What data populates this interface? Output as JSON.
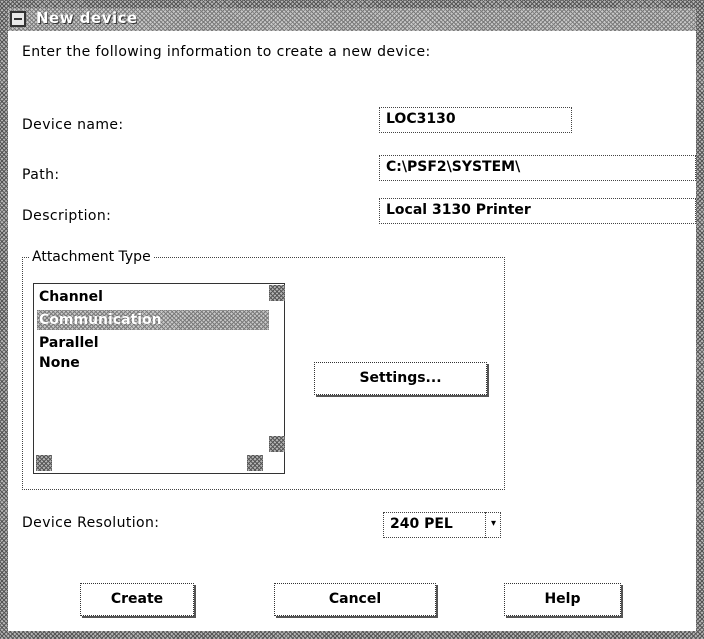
{
  "window": {
    "title": "New device"
  },
  "intro": "Enter the following information to create a new device:",
  "fields": {
    "device_name": {
      "label": "Device name:",
      "value": "LOC3130"
    },
    "path": {
      "label": "Path:",
      "value": "C:\\PSF2\\SYSTEM\\"
    },
    "description": {
      "label": "Description:",
      "value": "Local 3130 Printer"
    }
  },
  "attachment": {
    "group_label": "Attachment Type",
    "items": [
      "Channel",
      "Communication",
      "Parallel",
      "None"
    ],
    "selected": "Communication",
    "settings_button": "Settings..."
  },
  "resolution": {
    "label": "Device Resolution:",
    "value": "240 PEL",
    "arrow": "▾"
  },
  "buttons": {
    "create": "Create",
    "cancel": "Cancel",
    "help": "Help"
  }
}
